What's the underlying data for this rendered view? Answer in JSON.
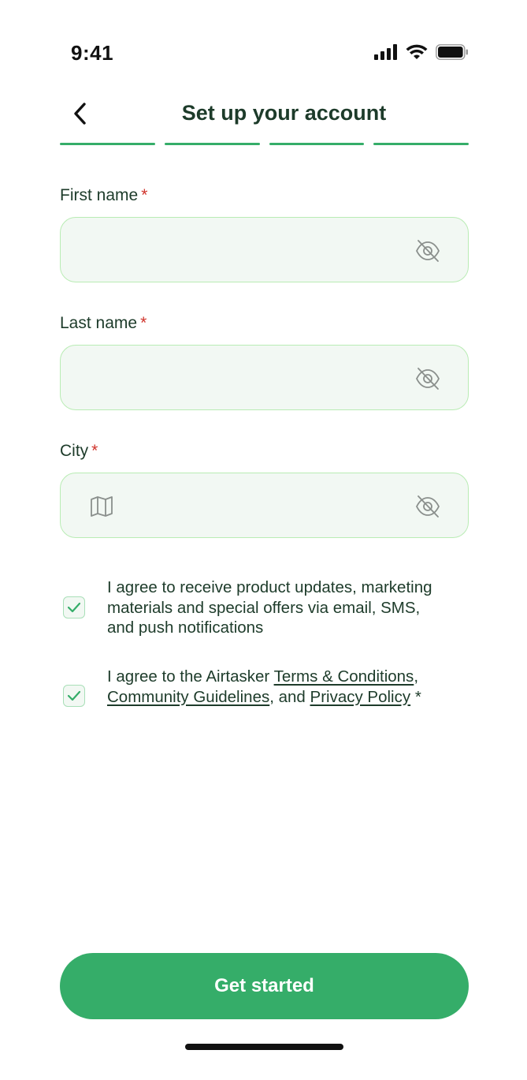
{
  "status_bar": {
    "time": "9:41",
    "icons": [
      "cellular-signal-icon",
      "wifi-icon",
      "battery-icon"
    ]
  },
  "header": {
    "back_icon": "chevron-left-icon",
    "title": "Set up your account"
  },
  "progress": {
    "total_steps": 4,
    "completed_steps": 4,
    "color": "#35ad69"
  },
  "form": {
    "required_marker": "*",
    "first_name": {
      "label": "First name",
      "value": "",
      "trailing_icon": "eye-off-icon"
    },
    "last_name": {
      "label": "Last name",
      "value": "",
      "trailing_icon": "eye-off-icon"
    },
    "city": {
      "label": "City",
      "value": "",
      "leading_icon": "map-icon",
      "trailing_icon": "eye-off-icon"
    }
  },
  "consents": {
    "marketing": {
      "checked": true,
      "text": "I agree to receive product updates, marketing materials and special offers via email, SMS, and push notifications"
    },
    "terms": {
      "checked": true,
      "prefix": "I agree to the Airtasker ",
      "terms_link": "Terms & Conditions",
      "separator": ", ",
      "guidelines_link": "Community Guidelines",
      "conjunction": ", and ",
      "privacy_link": "Privacy Policy",
      "suffix": " *"
    }
  },
  "cta": {
    "label": "Get started"
  },
  "colors": {
    "accent": "#35ad69",
    "text": "#1d3b2a",
    "required": "#d0342c",
    "field_bg": "#f2f8f3",
    "field_border": "#b9ecb4"
  }
}
